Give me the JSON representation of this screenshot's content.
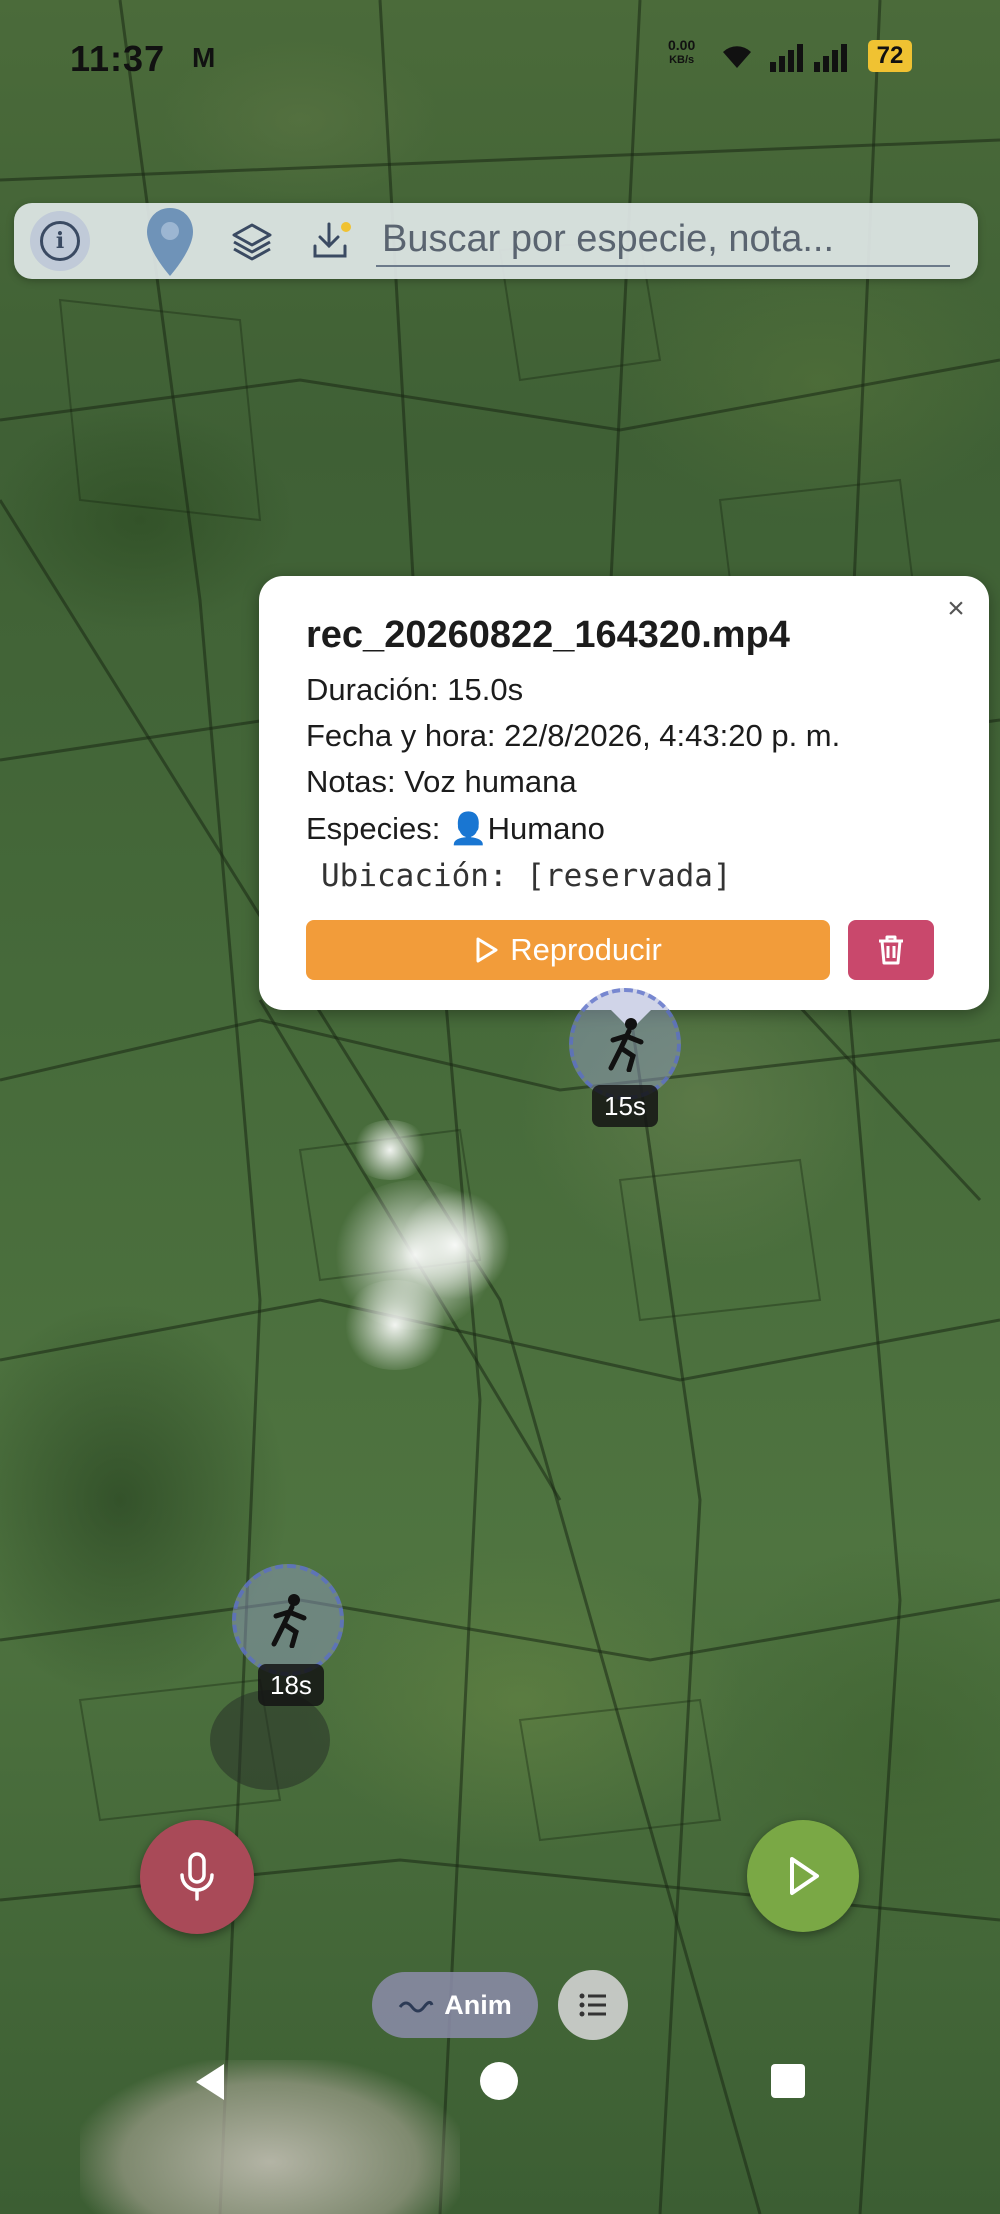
{
  "status_bar": {
    "time": "11:37",
    "mail_icon": "M",
    "net_speed_value": "0.00",
    "net_speed_unit": "KB/s",
    "battery": "72"
  },
  "toolbar": {
    "search_placeholder": "Buscar por especie, nota..."
  },
  "popup": {
    "close_label": "×",
    "filename": "rec_20260822_164320.mp4",
    "duration": "Duración: 15.0s",
    "datetime": "Fecha y hora: 22/8/2026, 4:43:20 p. m.",
    "notes": "Notas: Voz humana",
    "species_prefix": "Especies:",
    "species_icon": "👤",
    "species_name": "Humano",
    "location": "Ubicación: [reservada]",
    "play_label": "Reproducir",
    "colors": {
      "play": "#f29c3a",
      "delete": "#c9486c"
    }
  },
  "markers": [
    {
      "label": "15s"
    },
    {
      "label": "18s"
    }
  ],
  "controls": {
    "anim_label": "Anim",
    "colors": {
      "mic": "#a94a58",
      "play": "#7aa845"
    }
  }
}
